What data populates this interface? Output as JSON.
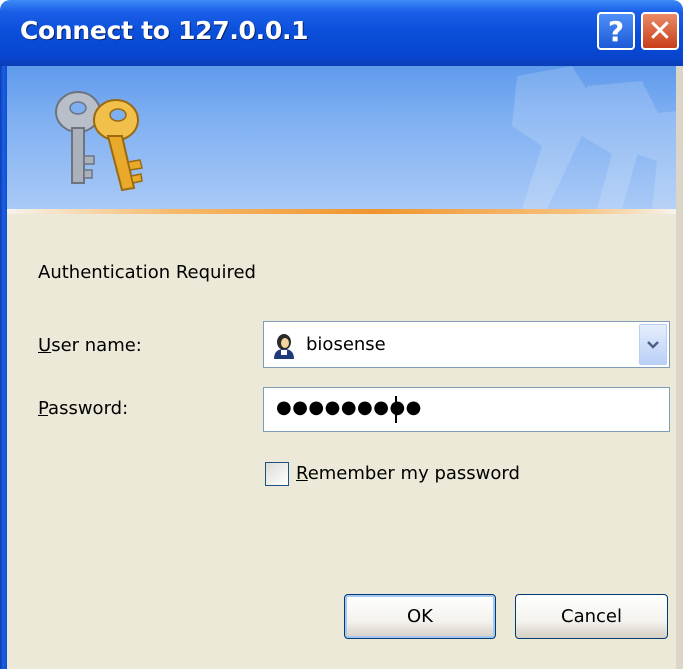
{
  "window": {
    "title": "Connect to 127.0.0.1",
    "help_glyph": "?",
    "close_glyph": "✕"
  },
  "banner": {
    "icon": "keys-icon",
    "watermark_icon": "keys-watermark-icon"
  },
  "form": {
    "heading": "Authentication Required",
    "username_label_first": "U",
    "username_label_rest": "ser name:",
    "username_value": "biosense",
    "username_icon": "user-icon",
    "password_label_first": "P",
    "password_label_rest": "assword:",
    "password_masked": "●●●●●●●●●",
    "remember_label_first": "R",
    "remember_label_rest": "emember my password",
    "remember_checked": false
  },
  "buttons": {
    "ok": "OK",
    "cancel": "Cancel"
  },
  "colors": {
    "titlebar": "#0a4fd9",
    "dialog_bg": "#ece9d8",
    "close_button": "#c93e1a",
    "banner_stripe": "#f0952e"
  }
}
